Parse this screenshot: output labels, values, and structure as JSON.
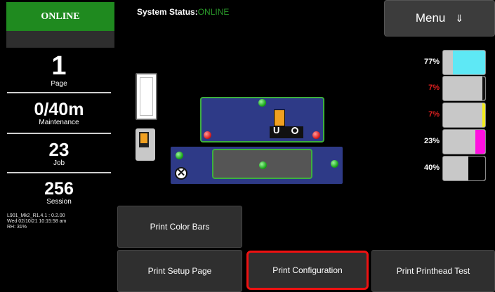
{
  "connection": {
    "status_label": "ONLINE"
  },
  "counters": {
    "page": {
      "value": "1",
      "label": "Page"
    },
    "maintenance": {
      "value": "0/40m",
      "label": "Maintenance"
    },
    "job": {
      "value": "23",
      "label": "Job"
    },
    "session": {
      "value": "256",
      "label": "Session"
    }
  },
  "version_info": {
    "line1": "L901_Mk2_R1.4.1 : 0.2.00",
    "line2": "Wed 02/10/21 10:15:58 am",
    "line3": "RH: 31%"
  },
  "system_status": {
    "label": "System Status:",
    "value": "ONLINE"
  },
  "menu": {
    "label": "Menu",
    "icon": "arrow-down-icon",
    "glyph": "⇓"
  },
  "ink_levels": [
    {
      "label": "77%",
      "level": 0.77,
      "color": "#5ee8f5",
      "label_color": "#ffffff"
    },
    {
      "label": "7%",
      "level": 0.07,
      "color": "#111111",
      "label_color": "#e02020"
    },
    {
      "label": "7%",
      "level": 0.07,
      "color": "#f2ec1c",
      "label_color": "#e02020"
    },
    {
      "label": "23%",
      "level": 0.23,
      "color": "#ff10e0",
      "label_color": "#ffffff"
    },
    {
      "label": "40%",
      "level": 0.4,
      "color": "#000000",
      "label_color": "#ffffff"
    }
  ],
  "actions": {
    "print_color_bars": "Print Color Bars",
    "print_setup_page": "Print Setup Page",
    "print_configuration": "Print Configuration",
    "print_printhead_test": "Print Printhead Test"
  },
  "colors": {
    "online_green": "#1f8a1f",
    "highlight_red": "#ee1111",
    "plate_blue": "#2e3a87"
  }
}
